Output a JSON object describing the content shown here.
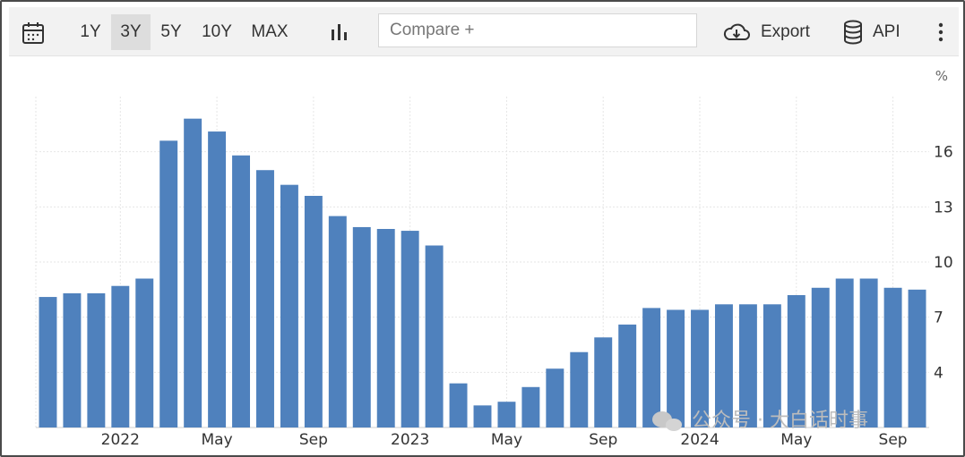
{
  "toolbar": {
    "ranges": [
      "1Y",
      "3Y",
      "5Y",
      "10Y",
      "MAX"
    ],
    "active_range": "3Y",
    "compare_placeholder": "Compare +",
    "export_label": "Export",
    "api_label": "API",
    "icons": {
      "calendar": "calendar-icon",
      "chart_type": "bar-chart-icon",
      "export": "cloud-download-icon",
      "api": "database-icon",
      "more": "more-vertical-icon"
    }
  },
  "watermark": "公众号 · 大白话时事",
  "chart_data": {
    "type": "bar",
    "title": "",
    "xlabel": "",
    "ylabel": "",
    "unit": "%",
    "y_ticks": [
      4,
      7,
      10,
      13,
      16
    ],
    "ylim": [
      1,
      19
    ],
    "x_tick_labels": [
      {
        "label": "2022",
        "index": 3.5
      },
      {
        "label": "May",
        "index": 7.5
      },
      {
        "label": "Sep",
        "index": 11.5
      },
      {
        "label": "2023",
        "index": 15.5
      },
      {
        "label": "May",
        "index": 19.5
      },
      {
        "label": "Sep",
        "index": 23.5
      },
      {
        "label": "2024",
        "index": 27.5
      },
      {
        "label": "May",
        "index": 31.5
      },
      {
        "label": "Sep",
        "index": 35.5
      }
    ],
    "categories": [
      "2021-10",
      "2021-11",
      "2021-12",
      "2022-01",
      "2022-02",
      "2022-03",
      "2022-04",
      "2022-05",
      "2022-06",
      "2022-07",
      "2022-08",
      "2022-09",
      "2022-10",
      "2022-11",
      "2022-12",
      "2023-01",
      "2023-02",
      "2023-03",
      "2023-04",
      "2023-05",
      "2023-06",
      "2023-07",
      "2023-08",
      "2023-09",
      "2023-10",
      "2023-11",
      "2023-12",
      "2024-01",
      "2024-02",
      "2024-03",
      "2024-04",
      "2024-05",
      "2024-06",
      "2024-07",
      "2024-08",
      "2024-09",
      "2024-10",
      "2024-11"
    ],
    "values": [
      8.1,
      8.3,
      8.3,
      8.7,
      9.1,
      16.6,
      17.8,
      17.1,
      15.8,
      15.0,
      14.2,
      13.6,
      12.5,
      11.9,
      11.8,
      11.7,
      10.9,
      3.4,
      2.2,
      2.4,
      3.2,
      4.2,
      5.1,
      5.9,
      6.6,
      7.5,
      7.4,
      7.4,
      7.7,
      7.7,
      7.7,
      8.2,
      8.6,
      9.1,
      9.1,
      8.6,
      8.5
    ]
  }
}
